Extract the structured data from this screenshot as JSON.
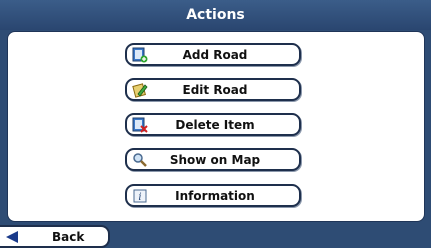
{
  "title": "Actions",
  "menu": {
    "items": [
      {
        "label": "Add Road",
        "icon": "add-road-icon"
      },
      {
        "label": "Edit Road",
        "icon": "edit-road-icon"
      },
      {
        "label": "Delete Item",
        "icon": "delete-item-icon"
      },
      {
        "label": "Show on Map",
        "icon": "magnifier-icon"
      },
      {
        "label": "Information",
        "icon": "information-icon"
      }
    ]
  },
  "footer": {
    "back_label": "Back",
    "back_icon": "back-arrow-icon"
  },
  "colors": {
    "background": "#2e4c74",
    "panel": "#ffffff",
    "button_border": "#1e2f4c"
  }
}
